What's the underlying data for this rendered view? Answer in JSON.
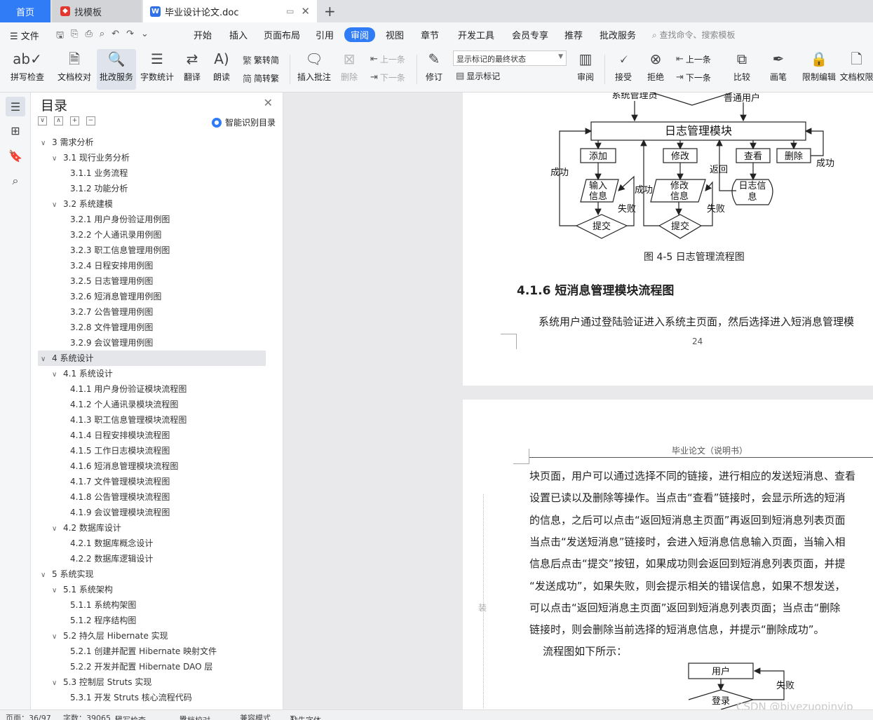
{
  "tabs": {
    "home": "首页",
    "template": "找模板",
    "document": "毕业设计论文.doc"
  },
  "menu": {
    "file": "文件",
    "items": [
      "开始",
      "插入",
      "页面布局",
      "引用",
      "审阅",
      "视图",
      "章节",
      "开发工具",
      "会员专享",
      "推荐",
      "批改服务"
    ],
    "active": "审阅",
    "search_placeholder": "查找命令、搜索模板"
  },
  "ribbon": {
    "spell_check": "拼写检查",
    "doc_proof": "文档校对",
    "grading": "批改服务",
    "word_count": "字数统计",
    "translate": "翻译",
    "read_aloud": "朗读",
    "to_traditional": "繁转简",
    "to_simplified": "简转繁",
    "insert_comment": "插入批注",
    "delete": "删除",
    "prev": "上一条",
    "next": "下一条",
    "track_changes": "修订",
    "markup_select": "显示标记的最终状态",
    "show_markup": "显示标记",
    "review": "审阅",
    "accept": "接受",
    "reject": "拒绝",
    "prev2": "上一条",
    "next2": "下一条",
    "compare": "比较",
    "pen": "画笔",
    "restrict": "限制编辑",
    "doc_rights": "文档权限"
  },
  "toc": {
    "title": "目录",
    "smart": "智能识别目录",
    "items": [
      {
        "level": 1,
        "text": "3  需求分析",
        "chev": "∨"
      },
      {
        "level": 2,
        "text": "3.1  现行业务分析",
        "chev": "∨"
      },
      {
        "level": 3,
        "text": "3.1.1  业务流程"
      },
      {
        "level": 3,
        "text": "3.1.2  功能分析"
      },
      {
        "level": 2,
        "text": "3.2  系统建模",
        "chev": "∨"
      },
      {
        "level": 3,
        "text": "3.2.1  用户身份验证用例图"
      },
      {
        "level": 3,
        "text": "3.2.2  个人通讯录用例图"
      },
      {
        "level": 3,
        "text": "3.2.3  职工信息管理用例图"
      },
      {
        "level": 3,
        "text": "3.2.4  日程安排用例图"
      },
      {
        "level": 3,
        "text": "3.2.5  日志管理用例图"
      },
      {
        "level": 3,
        "text": "3.2.6  短消息管理用例图"
      },
      {
        "level": 3,
        "text": "3.2.7  公告管理用例图"
      },
      {
        "level": 3,
        "text": "3.2.8  文件管理用例图"
      },
      {
        "level": 3,
        "text": "3.2.9  会议管理用例图"
      },
      {
        "level": 1,
        "text": "4  系统设计",
        "chev": "∨",
        "selected": true
      },
      {
        "level": 2,
        "text": "4.1  系统设计",
        "chev": "∨"
      },
      {
        "level": 3,
        "text": "4.1.1  用户身份验证模块流程图"
      },
      {
        "level": 3,
        "text": "4.1.2  个人通讯录模块流程图"
      },
      {
        "level": 3,
        "text": "4.1.3  职工信息管理模块流程图"
      },
      {
        "level": 3,
        "text": "4.1.4  日程安排模块流程图"
      },
      {
        "level": 3,
        "text": "4.1.5  工作日志模块流程图"
      },
      {
        "level": 3,
        "text": "4.1.6  短消息管理模块流程图"
      },
      {
        "level": 3,
        "text": "4.1.7  文件管理模块流程图"
      },
      {
        "level": 3,
        "text": "4.1.8  公告管理模块流程图"
      },
      {
        "level": 3,
        "text": "4.1.9  会议管理模块流程图"
      },
      {
        "level": 2,
        "text": "4.2  数据库设计",
        "chev": "∨"
      },
      {
        "level": 3,
        "text": "4.2.1  数据库概念设计"
      },
      {
        "level": 3,
        "text": "4.2.2  数据库逻辑设计"
      },
      {
        "level": 1,
        "text": "5  系统实现",
        "chev": "∨"
      },
      {
        "level": 2,
        "text": "5.1  系统架构",
        "chev": "∨"
      },
      {
        "level": 3,
        "text": "5.1.1  系统构架图"
      },
      {
        "level": 3,
        "text": "5.1.2  程序结构图"
      },
      {
        "level": 2,
        "text": "5.2  持久层 Hibernate 实现",
        "chev": "∨"
      },
      {
        "level": 3,
        "text": "5.2.1  创建并配置 Hibernate 映射文件"
      },
      {
        "level": 3,
        "text": "5.2.2  开发并配置 Hibernate DAO 层"
      },
      {
        "level": 2,
        "text": "5.3  控制层 Struts 实现",
        "chev": "∨"
      },
      {
        "level": 3,
        "text": "5.3.1  开发 Struts 核心流程代码"
      }
    ]
  },
  "document": {
    "flowchart": {
      "top_left": "系统管理员",
      "top_right": "普通用户",
      "main": "日志管理模块",
      "add": "添加",
      "modify": "修改",
      "view": "查看",
      "delete": "删除",
      "input_l1": "输入",
      "input_l2": "信息",
      "modinfo_l1": "修改",
      "modinfo_l2": "信息",
      "loginfo_l1": "日志信",
      "loginfo_l2": "息",
      "submit1": "提交",
      "submit2": "提交",
      "success_left": "成功",
      "success_mid": "成功",
      "success_right": "成功",
      "fail1": "失败",
      "fail2": "失败",
      "return": "返回"
    },
    "figure_caption": "图 4-5 日志管理流程图",
    "heading": "4.1.6  短消息管理模块流程图",
    "para1": "系统用户通过登陆验证进入系统主页面，然后选择进入短消息管理模",
    "page_number": "24",
    "page2_header": "毕业论文（说明书）",
    "body_lines": [
      "块页面，用户可以通过选择不同的链接，进行相应的发送短消息、查看",
      "设置已读以及删除等操作。当点击“查看”链接时，会显示所选的短消",
      "的信息，之后可以点击“返回短消息主页面”再返回到短消息列表页面",
      "当点击“发送短消息”链接时，会进入短消息信息输入页面，当输入相",
      "信息后点击“提交”按钮，如果成功则会返回到短消息列表页面，并提",
      "“发送成功”，如果失败，则会提示相关的错误信息，如果不想发送，",
      "可以点击“返回短消息主页面”返回到短消息列表页面；当点击“删除",
      "链接时，则会删除当前选择的短消息信息，并提示“删除成功”。",
      "    流程图如下所示："
    ],
    "flow2": {
      "user": "用户",
      "login": "登录",
      "fail": "失败"
    },
    "margin_mark": "装"
  },
  "watermark": "CSDN @biyezuopinvip",
  "status": {
    "page": "页面：36/97",
    "words": "字数：39065",
    "spell": "拼写检查",
    "proof": "文档校对",
    "compat": "兼容模式",
    "missing_font": "缺失字体"
  }
}
